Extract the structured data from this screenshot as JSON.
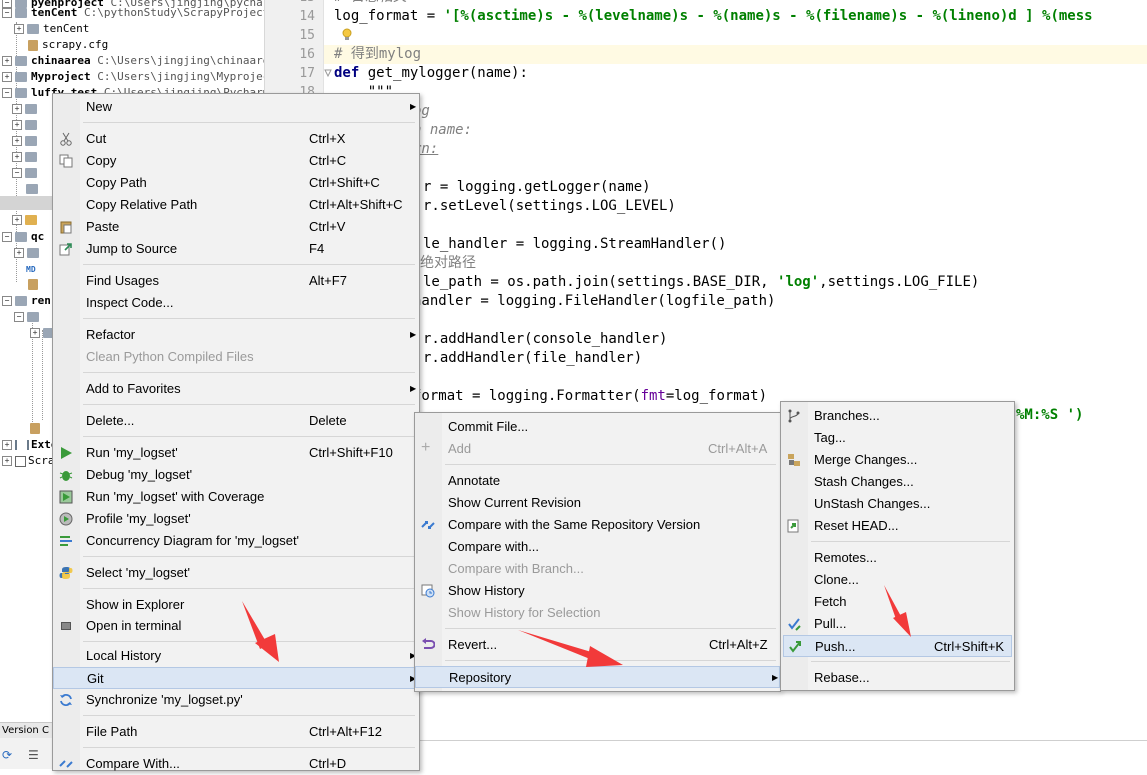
{
  "project_tree": {
    "rows": [
      {
        "name": "pyenproject",
        "path": "C:\\Users\\jingjing\\pycharmProj"
      },
      {
        "name": "tenCent",
        "path": "C:\\pythonStudy\\ScrapyProject\\t"
      },
      {
        "name": "tenCent",
        "path": ""
      },
      {
        "name": "scrapy.cfg",
        "path": ""
      },
      {
        "name": "chinaarea",
        "path": "C:\\Users\\jingjing\\chinaarea"
      },
      {
        "name": "Myproject",
        "path": "C:\\Users\\jingjing\\Myproject"
      },
      {
        "name": "luffy_test",
        "path": "C:\\Users\\jingjing\\PycharmP"
      },
      {
        "name": "qc",
        "path": ""
      },
      {
        "name": "MD",
        "path": ""
      },
      {
        "name": "ren",
        "path": ""
      },
      {
        "name": "Exte",
        "path": ""
      },
      {
        "name": "Scra",
        "path": ""
      }
    ],
    "version_control_label": "Version C"
  },
  "editor": {
    "lines": [
      {
        "num": "14",
        "prefix": "log_format = ",
        "string": "'[%(asctime)s - %(levelname)s - %(name)s - %(filename)s - %(lineno)d ] %(mess",
        "rest": ""
      },
      {
        "num": "15",
        "text": ""
      },
      {
        "num": "16",
        "comment": "# 得到mylog"
      },
      {
        "num": "17",
        "kw": "def",
        "rest": " get_mylogger(name):"
      },
      {
        "num": "18",
        "text": "    \"\"\""
      }
    ],
    "fragments": [
      {
        "text": "og",
        "style": "cm"
      },
      {
        "text": "n name:",
        "style": "cm"
      },
      {
        "text": "rn:",
        "style": "cm"
      },
      {
        "text": "r = logging.getLogger(name)",
        "style": ""
      },
      {
        "text": "r.setLevel(settings.LOG_LEVEL)",
        "style": ""
      },
      {
        "text": "le_handler = logging.StreamHandler()",
        "style": ""
      },
      {
        "text": "绝对路径",
        "style": "cmn"
      },
      {
        "text": "le_path = os.path.join(settings.BASE_DIR, ",
        "style": "",
        "str": "'log'",
        "after": ",settings.LOG_FILE)"
      },
      {
        "text": "handler = logging.FileHandler(logfile_path)",
        "style": ""
      },
      {
        "text": "r.addHandler(console_handler)",
        "style": ""
      },
      {
        "text": "r.addHandler(file_handler)",
        "style": ""
      },
      {
        "text": "format = logging.Formatter(",
        "style": "",
        "prm": "fmt",
        "after": "=log_format)"
      },
      {
        "text": "%M:%S ')",
        "style": "str"
      }
    ]
  },
  "context_menu": {
    "items": [
      {
        "label": "New",
        "shortcut": "",
        "submenu": true,
        "icon": ""
      },
      {
        "label": "Cut",
        "shortcut": "Ctrl+X",
        "icon": "scissors-icon"
      },
      {
        "label": "Copy",
        "shortcut": "Ctrl+C",
        "icon": "copy-icon"
      },
      {
        "label": "Copy Path",
        "shortcut": "Ctrl+Shift+C",
        "icon": ""
      },
      {
        "label": "Copy Relative Path",
        "shortcut": "Ctrl+Alt+Shift+C",
        "icon": ""
      },
      {
        "label": "Paste",
        "shortcut": "Ctrl+V",
        "icon": "paste-icon"
      },
      {
        "label": "Jump to Source",
        "shortcut": "F4",
        "icon": "jump-icon"
      },
      {
        "label": "Find Usages",
        "shortcut": "Alt+F7",
        "icon": ""
      },
      {
        "label": "Inspect Code...",
        "shortcut": "",
        "icon": ""
      },
      {
        "label": "Refactor",
        "shortcut": "",
        "submenu": true,
        "icon": ""
      },
      {
        "label": "Clean Python Compiled Files",
        "shortcut": "",
        "disabled": true,
        "icon": ""
      },
      {
        "label": "Add to Favorites",
        "shortcut": "",
        "submenu": true,
        "icon": ""
      },
      {
        "label": "Delete...",
        "shortcut": "Delete",
        "icon": ""
      },
      {
        "label": "Run 'my_logset'",
        "shortcut": "Ctrl+Shift+F10",
        "icon": "run-icon"
      },
      {
        "label": "Debug 'my_logset'",
        "shortcut": "",
        "icon": "debug-icon"
      },
      {
        "label": "Run 'my_logset' with Coverage",
        "shortcut": "",
        "icon": "coverage-icon"
      },
      {
        "label": "Profile 'my_logset'",
        "shortcut": "",
        "icon": "profile-icon"
      },
      {
        "label": "Concurrency Diagram for 'my_logset'",
        "shortcut": "",
        "icon": "concurrency-icon"
      },
      {
        "label": "Select 'my_logset'",
        "shortcut": "",
        "icon": "python-icon"
      },
      {
        "label": "Show in Explorer",
        "shortcut": "",
        "icon": ""
      },
      {
        "label": "Open in terminal",
        "shortcut": "",
        "icon": "terminal-icon"
      },
      {
        "label": "Local History",
        "shortcut": "",
        "submenu": true,
        "icon": ""
      },
      {
        "label": "Git",
        "shortcut": "",
        "submenu": true,
        "selected": true,
        "icon": ""
      },
      {
        "label": "Synchronize 'my_logset.py'",
        "shortcut": "",
        "icon": "sync-icon"
      },
      {
        "label": "File Path",
        "shortcut": "Ctrl+Alt+F12",
        "icon": ""
      },
      {
        "label": "Compare With...",
        "shortcut": "Ctrl+D",
        "icon": "compare-icon"
      }
    ]
  },
  "git_menu": {
    "items": [
      {
        "label": "Commit File...",
        "shortcut": ""
      },
      {
        "label": "Add",
        "shortcut": "Ctrl+Alt+A",
        "disabled": true,
        "icon": "plus-icon"
      },
      {
        "label": "Annotate",
        "shortcut": ""
      },
      {
        "label": "Show Current Revision",
        "shortcut": ""
      },
      {
        "label": "Compare with the Same Repository Version",
        "shortcut": "",
        "icon": "compare-arrows-icon"
      },
      {
        "label": "Compare with...",
        "shortcut": ""
      },
      {
        "label": "Compare with Branch...",
        "shortcut": "",
        "disabled": true
      },
      {
        "label": "Show History",
        "shortcut": "",
        "icon": "history-icon"
      },
      {
        "label": "Show History for Selection",
        "shortcut": "",
        "disabled": true
      },
      {
        "label": "Revert...",
        "shortcut": "Ctrl+Alt+Z",
        "icon": "revert-icon"
      },
      {
        "label": "Repository",
        "shortcut": "",
        "submenu": true,
        "selected": true
      }
    ]
  },
  "repository_menu": {
    "items": [
      {
        "label": "Branches...",
        "shortcut": "",
        "icon": "branch-icon"
      },
      {
        "label": "Tag...",
        "shortcut": ""
      },
      {
        "label": "Merge Changes...",
        "shortcut": "",
        "icon": "merge-icon"
      },
      {
        "label": "Stash Changes...",
        "shortcut": ""
      },
      {
        "label": "UnStash Changes...",
        "shortcut": ""
      },
      {
        "label": "Reset HEAD...",
        "shortcut": "",
        "icon": "reset-icon"
      },
      {
        "label": "Remotes...",
        "shortcut": ""
      },
      {
        "label": "Clone...",
        "shortcut": ""
      },
      {
        "label": "Fetch",
        "shortcut": ""
      },
      {
        "label": "Pull...",
        "shortcut": "",
        "icon": "pull-icon"
      },
      {
        "label": "Push...",
        "shortcut": "Ctrl+Shift+K",
        "selected": true,
        "icon": "push-icon"
      },
      {
        "label": "Rebase...",
        "shortcut": ""
      }
    ]
  },
  "colors": {
    "annotation_arrow": "#f23a3a",
    "menu_selection": "#dbe6f4"
  }
}
